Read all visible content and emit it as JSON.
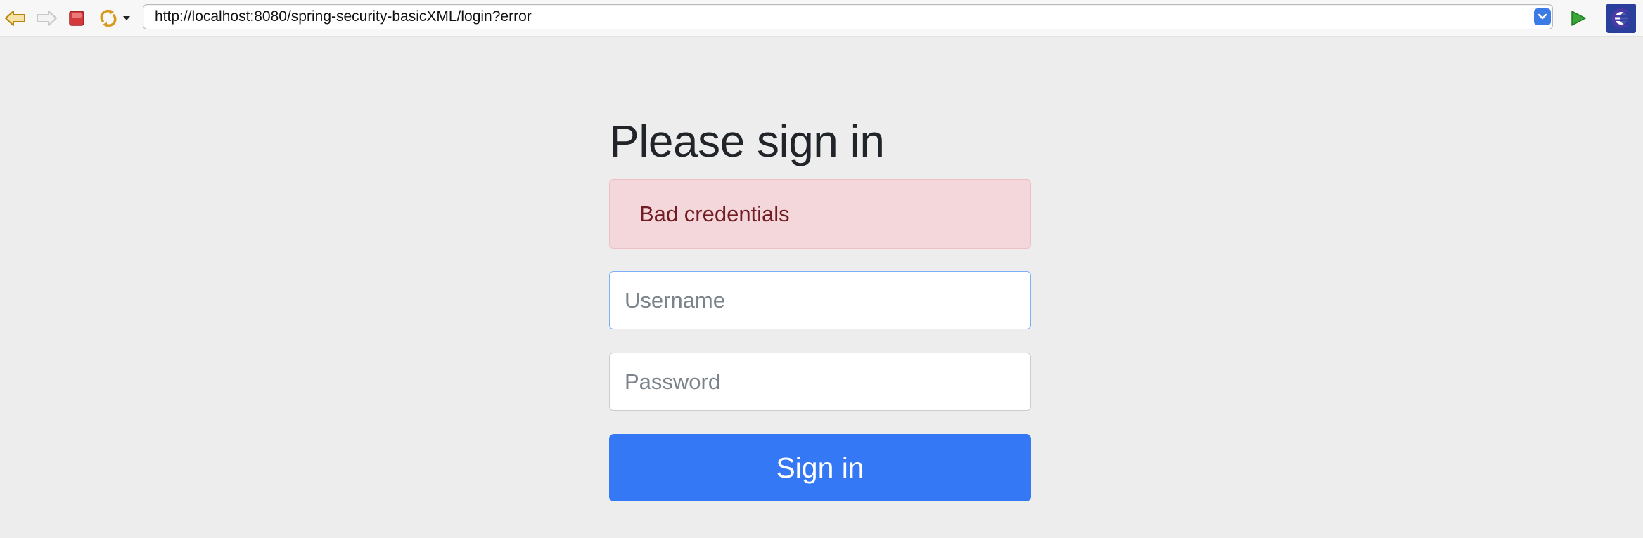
{
  "browser": {
    "url": "http://localhost:8080/spring-security-basicXML/login?error",
    "icons": [
      "back-arrow-icon",
      "forward-arrow-icon",
      "stop-icon",
      "refresh-icon",
      "dropdown-caret-icon",
      "url-dropdown-icon",
      "go-arrow-icon",
      "eclipse-icon"
    ]
  },
  "login": {
    "heading": "Please sign in",
    "error_message": "Bad credentials",
    "username_placeholder": "Username",
    "password_placeholder": "Password",
    "submit_label": "Sign in"
  },
  "colors": {
    "page_background": "#ededed",
    "alert_background": "#f4d7da",
    "alert_text": "#721c24",
    "button_background": "#3578f5",
    "focus_border": "#7fb0f7"
  }
}
